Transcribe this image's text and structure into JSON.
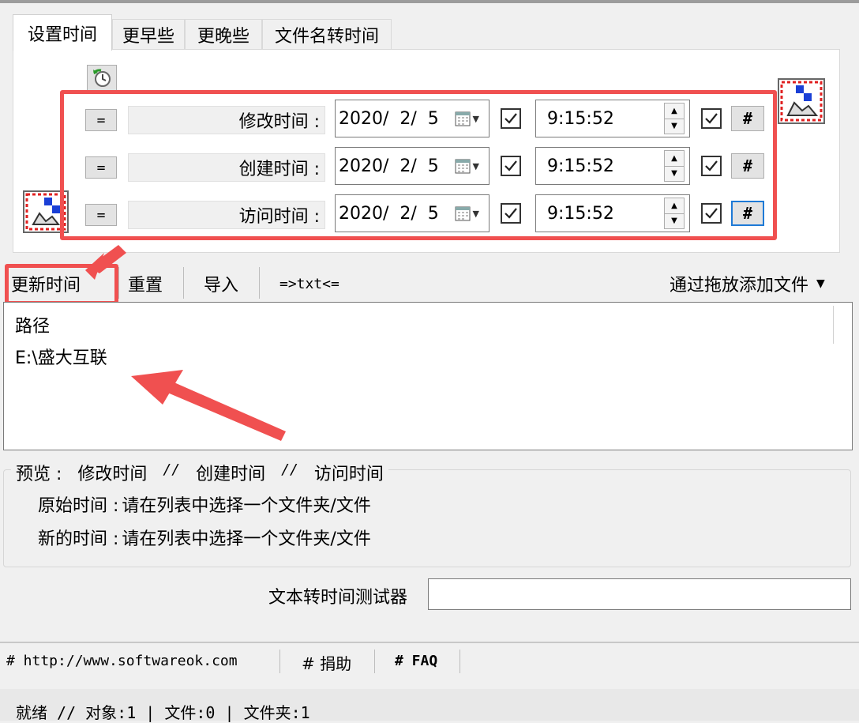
{
  "tabs": [
    "设置时间",
    "更早些",
    "更晚些",
    "文件名转时间"
  ],
  "rows": [
    {
      "label": "修改时间 :",
      "date": "2020/  2/  5",
      "time": "9:15:52",
      "eq": "=",
      "hash": "#"
    },
    {
      "label": "创建时间 :",
      "date": "2020/  2/  5",
      "time": "9:15:52",
      "eq": "=",
      "hash": "#"
    },
    {
      "label": "访问时间 :",
      "date": "2020/  2/  5",
      "time": "9:15:52",
      "eq": "=",
      "hash": "#"
    }
  ],
  "toolbar": {
    "update": "更新时间",
    "reset": "重置",
    "import": "导入",
    "txt": "=>txt<=",
    "drag_add": "通过拖放添加文件"
  },
  "list": {
    "header": "路径",
    "items": [
      "E:\\盛大互联"
    ]
  },
  "preview": {
    "legend": "预览 :",
    "modified": "修改时间",
    "created": "创建时间",
    "accessed": "访问时间",
    "sep": "//",
    "original_label": "原始时间 :",
    "original_value": "请在列表中选择一个文件夹/文件",
    "new_label": "新的时间 :",
    "new_value": "请在列表中选择一个文件夹/文件"
  },
  "tester": {
    "label": "文本转时间测试器",
    "value": ""
  },
  "links": {
    "site": "# http://www.softwareok.com",
    "donate": "# 捐助",
    "faq": "# FAQ"
  },
  "status": "就绪 // 对象:1 | 文件:0   | 文件夹:1",
  "colors": {
    "annotation": "#f05050",
    "focus": "#1e7ad6"
  },
  "icons": [
    "clock-refresh-icon",
    "calendar-dropdown-icon",
    "file-time-icon"
  ]
}
